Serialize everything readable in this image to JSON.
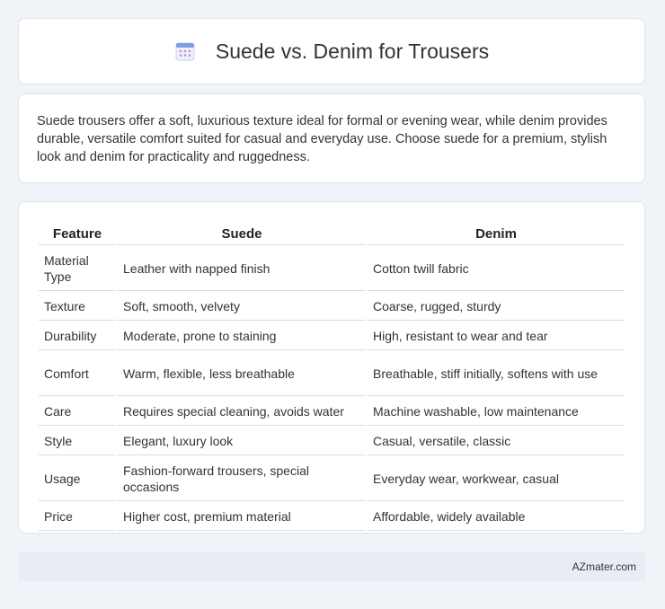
{
  "header": {
    "title": "Suede vs. Denim for Trousers",
    "icon": "calendar-icon"
  },
  "intro": {
    "text": "Suede trousers offer a soft, luxurious texture ideal for formal or evening wear, while denim provides durable, versatile comfort suited for casual and everyday use. Choose suede for a premium, stylish look and denim for practicality and ruggedness."
  },
  "table": {
    "headers": [
      "Feature",
      "Suede",
      "Denim"
    ],
    "rows": [
      [
        "Material Type",
        "Leather with napped finish",
        "Cotton twill fabric"
      ],
      [
        "Texture",
        "Soft, smooth, velvety",
        "Coarse, rugged, sturdy"
      ],
      [
        "Durability",
        "Moderate, prone to staining",
        "High, resistant to wear and tear"
      ],
      [
        "Comfort",
        "Warm, flexible, less breathable",
        "Breathable, stiff initially, softens with use"
      ],
      [
        "Care",
        "Requires special cleaning, avoids water",
        "Machine washable, low maintenance"
      ],
      [
        "Style",
        "Elegant, luxury look",
        "Casual, versatile, classic"
      ],
      [
        "Usage",
        "Fashion-forward trousers, special occasions",
        "Everyday wear, workwear, casual"
      ],
      [
        "Price",
        "Higher cost, premium material",
        "Affordable, widely available"
      ]
    ]
  },
  "footer": {
    "brand": "AZmater.com"
  }
}
